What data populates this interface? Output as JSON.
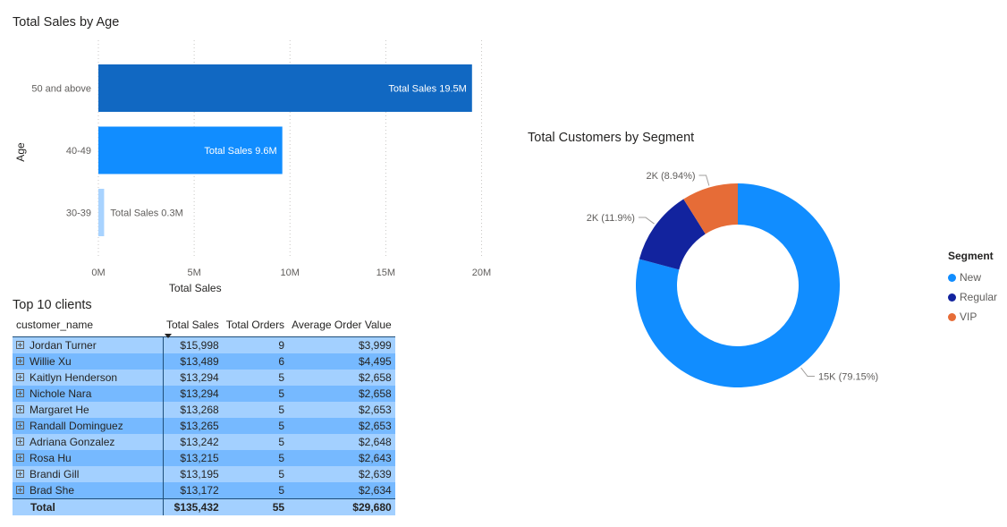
{
  "bar_chart": {
    "title": "Total Sales by Age",
    "ylabel": "Age",
    "xlabel": "Total Sales",
    "tick_labels": [
      "0M",
      "5M",
      "10M",
      "15M",
      "20M"
    ]
  },
  "donut_chart": {
    "title": "Total Customers by Segment",
    "legend_title": "Segment"
  },
  "chart_data": [
    {
      "type": "bar",
      "orientation": "horizontal",
      "title": "Total Sales by Age",
      "xlabel": "Total Sales",
      "ylabel": "Age",
      "categories": [
        "50 and above",
        "40-49",
        "30-39"
      ],
      "values": [
        19.5,
        9.6,
        0.3
      ],
      "unit": "M",
      "data_labels": [
        "Total Sales 19.5M",
        "Total Sales 9.6M",
        "Total Sales 0.3M"
      ],
      "colors": [
        "#1168c2",
        "#118dff",
        "#a8d3ff"
      ],
      "xlim": [
        0,
        20
      ],
      "xticks": [
        0,
        5,
        10,
        15,
        20
      ],
      "grid": "vertical-dotted"
    },
    {
      "type": "pie",
      "variant": "donut",
      "title": "Total Customers by Segment",
      "legend_title": "Segment",
      "legend_position": "right",
      "categories": [
        "New",
        "Regular",
        "VIP"
      ],
      "values": [
        79.15,
        11.9,
        8.94
      ],
      "data_labels": [
        "15K (79.15%)",
        "2K (11.9%)",
        "2K (8.94%)"
      ],
      "colors": [
        "#118dff",
        "#12239e",
        "#e66c37"
      ]
    }
  ],
  "table": {
    "title": "Top 10 clients",
    "columns": [
      "customer_name",
      "Total Sales",
      "Total Orders",
      "Average Order Value"
    ],
    "rows": [
      [
        "Jordan Turner",
        "$15,998",
        "9",
        "$3,999"
      ],
      [
        "Willie Xu",
        "$13,489",
        "6",
        "$4,495"
      ],
      [
        "Kaitlyn Henderson",
        "$13,294",
        "5",
        "$2,658"
      ],
      [
        "Nichole Nara",
        "$13,294",
        "5",
        "$2,658"
      ],
      [
        "Margaret He",
        "$13,268",
        "5",
        "$2,653"
      ],
      [
        "Randall Dominguez",
        "$13,265",
        "5",
        "$2,653"
      ],
      [
        "Adriana Gonzalez",
        "$13,242",
        "5",
        "$2,648"
      ],
      [
        "Rosa Hu",
        "$13,215",
        "5",
        "$2,643"
      ],
      [
        "Brandi Gill",
        "$13,195",
        "5",
        "$2,639"
      ],
      [
        "Brad She",
        "$13,172",
        "5",
        "$2,634"
      ]
    ],
    "total": [
      "Total",
      "$135,432",
      "55",
      "$29,680"
    ]
  }
}
